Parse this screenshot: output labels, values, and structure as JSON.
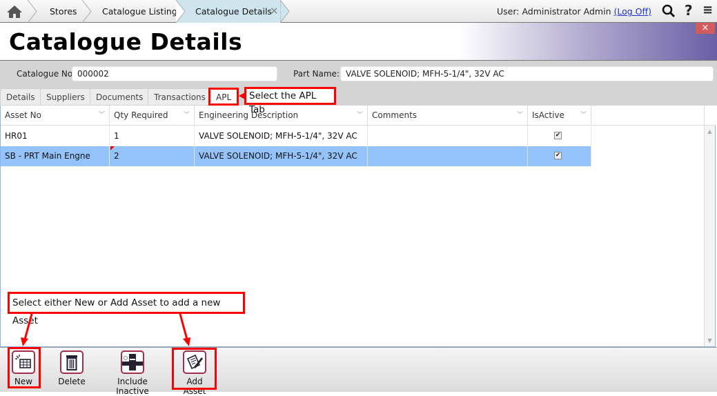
{
  "breadcrumb": {
    "home_icon": "home-icon",
    "items": [
      "Stores",
      "Catalogue Listing",
      "Catalogue Details"
    ]
  },
  "user": {
    "label": "User: Administrator Admin",
    "logoff": "(Log Off)"
  },
  "header_icons": [
    "search-icon",
    "help-icon",
    "menu-icon"
  ],
  "page": {
    "title": "Catalogue Details",
    "close": "×"
  },
  "fields": {
    "catalogue_no_label": "Catalogue No",
    "catalogue_no": "000002",
    "part_name_label": "Part Name:",
    "part_name": "VALVE SOLENOID; MFH-5-1/4\", 32V AC"
  },
  "tabs": [
    "Details",
    "Suppliers",
    "Documents",
    "Transactions",
    "APL"
  ],
  "active_tab": "APL",
  "grid": {
    "columns": [
      "Asset No",
      "Qty Required",
      "Engineering Description",
      "Comments",
      "IsActive"
    ],
    "rows": [
      {
        "asset": "HR01",
        "qty": "1",
        "desc": "VALVE SOLENOID; MFH-5-1/4\", 32V AC",
        "comments": "",
        "active": true,
        "selected": false
      },
      {
        "asset": "SB - PRT Main Engne",
        "qty": "2",
        "desc": "VALVE SOLENOID; MFH-5-1/4\", 32V AC",
        "comments": "",
        "active": true,
        "selected": true
      }
    ]
  },
  "toolbar": {
    "new": "New",
    "delete": "Delete",
    "include_inactive": "Include Inactive",
    "add_asset": "Add Asset"
  },
  "annotations": {
    "tab_hint": "Select the APL Tab",
    "new_hint": "Select either New or Add Asset to add a new Asset"
  },
  "colors": {
    "selected_row": "#94c3fb",
    "annotation": "#ff0000",
    "icon_border": "#a0304a"
  }
}
